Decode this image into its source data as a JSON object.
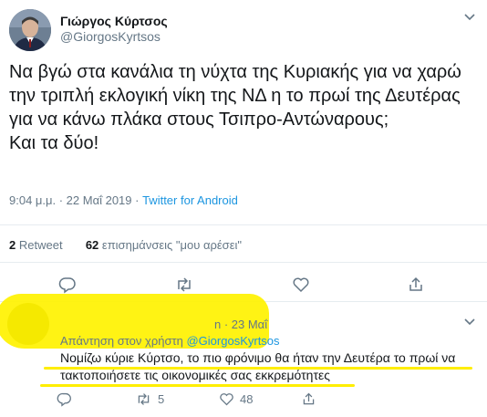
{
  "tweet": {
    "author_name": "Γιώργος Κύρτσος",
    "author_handle": "@GiorgosKyrtsos",
    "text": "Να βγώ στα κανάλια τη νύχτα της Κυριακής για να χαρώ την τριπλή εκλογική νίκη της ΝΔ η το πρωί της Δευτέρας για να κάνω πλάκα στους Τσιπρο-Αντώναρους;\nΚαι τα δύο!",
    "timestamp": "9:04 μ.μ. · 22 Μαΐ 2019",
    "separator": " · ",
    "source": "Twitter for Android",
    "retweet_count": "2",
    "retweet_label": "Retweet",
    "like_count": "62",
    "like_label": "επισημάνσεις \"μου αρέσει\""
  },
  "reply": {
    "date": "n · 23 Μαΐ",
    "reply_to_label": "Απάντηση στον χρήστη",
    "reply_to_handle": "@GiorgosKyrtsos",
    "text": "Νομίζω κύριε Κύρτσο, το πιο φρόνιμο θα ήταν την Δευτέρα το πρωί να τακτοποιήσετε τις οικονομικές σας εκκρεμότητες",
    "retweet_count": "5",
    "like_count": "48"
  },
  "icons": {
    "caret": "chevron-down-icon",
    "reply": "reply-icon",
    "retweet": "retweet-icon",
    "like": "heart-icon",
    "share": "share-icon"
  },
  "colors": {
    "link": "#1b95e0",
    "secondary_text": "#657786",
    "highlight": "#fff200"
  }
}
